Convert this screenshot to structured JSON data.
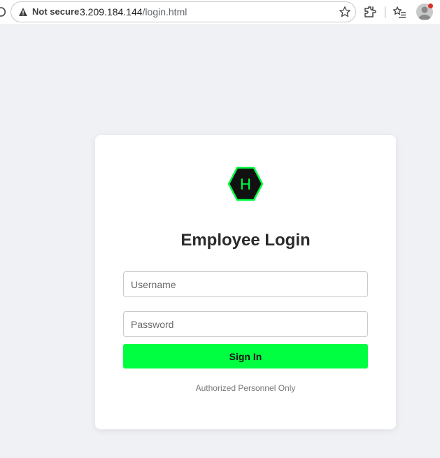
{
  "browser": {
    "security_label": "Not secure",
    "url_host": "3.209.184.144",
    "url_path": "/login.html"
  },
  "login": {
    "logo_letter": "H",
    "title": "Employee Login",
    "username_placeholder": "Username",
    "password_placeholder": "Password",
    "signin_label": "Sign In",
    "footnote": "Authorized Personnel Only"
  },
  "colors": {
    "accent": "#00ff41",
    "logo_fill": "#111111",
    "page_bg": "#eff1f5"
  },
  "icons": [
    "reload-icon",
    "warning-icon",
    "bookmark-star-icon",
    "extensions-icon",
    "favorites-icon",
    "profile-avatar-icon",
    "notification-dot"
  ]
}
